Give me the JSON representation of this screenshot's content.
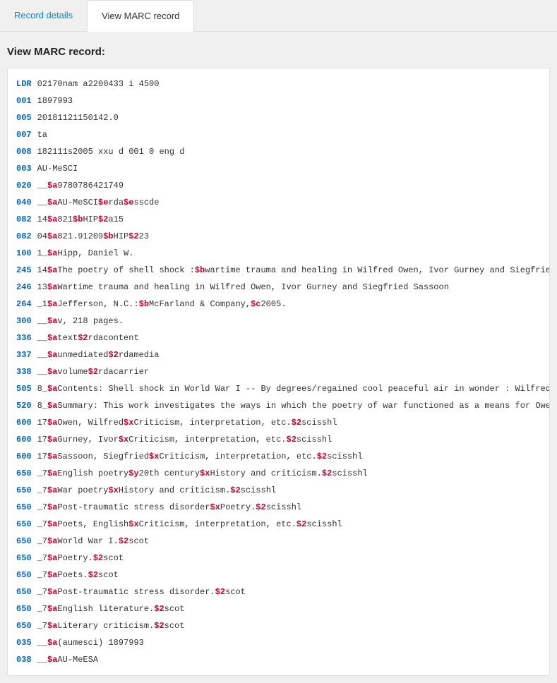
{
  "tabs": [
    {
      "label": "Record details",
      "active": false
    },
    {
      "label": "View MARC record",
      "active": true
    }
  ],
  "section_title": "View MARC record:",
  "marc": [
    {
      "tag": "LDR",
      "ind": "",
      "parts": [
        {
          "t": "txt",
          "v": "   02170nam a2200433 i 4500"
        }
      ]
    },
    {
      "tag": "001",
      "ind": "",
      "parts": [
        {
          "t": "txt",
          "v": "   1897993"
        }
      ]
    },
    {
      "tag": "005",
      "ind": "",
      "parts": [
        {
          "t": "txt",
          "v": "   20181121150142.0"
        }
      ]
    },
    {
      "tag": "007",
      "ind": "",
      "parts": [
        {
          "t": "txt",
          "v": "   ta"
        }
      ]
    },
    {
      "tag": "008",
      "ind": "",
      "parts": [
        {
          "t": "txt",
          "v": "   182111s2005    xxu    d      001 0 eng d"
        }
      ]
    },
    {
      "tag": "003",
      "ind": "",
      "parts": [
        {
          "t": "txt",
          "v": "   AU-MeSCI"
        }
      ]
    },
    {
      "tag": "020",
      "ind": "__",
      "parts": [
        {
          "t": "sub",
          "v": "$a"
        },
        {
          "t": "txt",
          "v": "9780786421749"
        }
      ]
    },
    {
      "tag": "040",
      "ind": "__",
      "parts": [
        {
          "t": "sub",
          "v": "$a"
        },
        {
          "t": "txt",
          "v": "AU-MeSCI"
        },
        {
          "t": "sub",
          "v": "$e"
        },
        {
          "t": "txt",
          "v": "rda"
        },
        {
          "t": "sub",
          "v": "$e"
        },
        {
          "t": "txt",
          "v": "sscde"
        }
      ]
    },
    {
      "tag": "082",
      "ind": "14",
      "parts": [
        {
          "t": "sub",
          "v": "$a"
        },
        {
          "t": "txt",
          "v": "821"
        },
        {
          "t": "sub",
          "v": "$b"
        },
        {
          "t": "txt",
          "v": "HIP"
        },
        {
          "t": "sub",
          "v": "$2"
        },
        {
          "t": "txt",
          "v": "a15"
        }
      ]
    },
    {
      "tag": "082",
      "ind": "04",
      "parts": [
        {
          "t": "sub",
          "v": "$a"
        },
        {
          "t": "txt",
          "v": "821.91209"
        },
        {
          "t": "sub",
          "v": "$b"
        },
        {
          "t": "txt",
          "v": "HIP"
        },
        {
          "t": "sub",
          "v": "$2"
        },
        {
          "t": "txt",
          "v": "23"
        }
      ]
    },
    {
      "tag": "100",
      "ind": "1_",
      "parts": [
        {
          "t": "sub",
          "v": "$a"
        },
        {
          "t": "txt",
          "v": "Hipp, Daniel W."
        }
      ]
    },
    {
      "tag": "245",
      "ind": "14",
      "parts": [
        {
          "t": "sub",
          "v": "$a"
        },
        {
          "t": "txt",
          "v": "The poetry of shell shock :"
        },
        {
          "t": "sub",
          "v": "$b"
        },
        {
          "t": "txt",
          "v": "wartime trauma and healing in Wilfred Owen, Ivor Gurney and Siegfried Sasso"
        }
      ]
    },
    {
      "tag": "246",
      "ind": "13",
      "parts": [
        {
          "t": "sub",
          "v": "$a"
        },
        {
          "t": "txt",
          "v": "Wartime trauma and healing in Wilfred Owen, Ivor Gurney and Siegfried Sassoon"
        }
      ]
    },
    {
      "tag": "264",
      "ind": "_1",
      "parts": [
        {
          "t": "sub",
          "v": "$a"
        },
        {
          "t": "txt",
          "v": "Jefferson, N.C.:"
        },
        {
          "t": "sub",
          "v": "$b"
        },
        {
          "t": "txt",
          "v": "McFarland & Company,"
        },
        {
          "t": "sub",
          "v": "$c"
        },
        {
          "t": "txt",
          "v": "2005."
        }
      ]
    },
    {
      "tag": "300",
      "ind": "__",
      "parts": [
        {
          "t": "sub",
          "v": "$a"
        },
        {
          "t": "txt",
          "v": "v, 218 pages."
        }
      ]
    },
    {
      "tag": "336",
      "ind": "__",
      "parts": [
        {
          "t": "sub",
          "v": "$a"
        },
        {
          "t": "txt",
          "v": "text"
        },
        {
          "t": "sub",
          "v": "$2"
        },
        {
          "t": "txt",
          "v": "rdacontent"
        }
      ]
    },
    {
      "tag": "337",
      "ind": "__",
      "parts": [
        {
          "t": "sub",
          "v": "$a"
        },
        {
          "t": "txt",
          "v": "unmediated"
        },
        {
          "t": "sub",
          "v": "$2"
        },
        {
          "t": "txt",
          "v": "rdamedia"
        }
      ]
    },
    {
      "tag": "338",
      "ind": "__",
      "parts": [
        {
          "t": "sub",
          "v": "$a"
        },
        {
          "t": "txt",
          "v": "volume"
        },
        {
          "t": "sub",
          "v": "$2"
        },
        {
          "t": "txt",
          "v": "rdacarrier"
        }
      ]
    },
    {
      "tag": "505",
      "ind": "8_",
      "parts": [
        {
          "t": "sub",
          "v": "$a"
        },
        {
          "t": "txt",
          "v": "Contents: Shell shock in World War I -- By degrees/regained cool peaceful air in wonder : Wilfred Owen, "
        }
      ]
    },
    {
      "tag": "520",
      "ind": "8_",
      "parts": [
        {
          "t": "sub",
          "v": "$a"
        },
        {
          "t": "txt",
          "v": "Summary: This work investigates the ways in which the poetry of war functioned as a means for Owen, Gurn"
        }
      ]
    },
    {
      "tag": "600",
      "ind": "17",
      "parts": [
        {
          "t": "sub",
          "v": "$a"
        },
        {
          "t": "txt",
          "v": "Owen, Wilfred"
        },
        {
          "t": "sub",
          "v": "$x"
        },
        {
          "t": "txt",
          "v": "Criticism, interpretation, etc."
        },
        {
          "t": "sub",
          "v": "$2"
        },
        {
          "t": "txt",
          "v": "scisshl"
        }
      ]
    },
    {
      "tag": "600",
      "ind": "17",
      "parts": [
        {
          "t": "sub",
          "v": "$a"
        },
        {
          "t": "txt",
          "v": "Gurney, Ivor"
        },
        {
          "t": "sub",
          "v": "$x"
        },
        {
          "t": "txt",
          "v": "Criticism, interpretation, etc."
        },
        {
          "t": "sub",
          "v": "$2"
        },
        {
          "t": "txt",
          "v": "scisshl"
        }
      ]
    },
    {
      "tag": "600",
      "ind": "17",
      "parts": [
        {
          "t": "sub",
          "v": "$a"
        },
        {
          "t": "txt",
          "v": "Sassoon, Siegfried"
        },
        {
          "t": "sub",
          "v": "$x"
        },
        {
          "t": "txt",
          "v": "Criticism, interpretation, etc."
        },
        {
          "t": "sub",
          "v": "$2"
        },
        {
          "t": "txt",
          "v": "scisshl"
        }
      ]
    },
    {
      "tag": "650",
      "ind": "_7",
      "parts": [
        {
          "t": "sub",
          "v": "$a"
        },
        {
          "t": "txt",
          "v": "English poetry"
        },
        {
          "t": "sub",
          "v": "$y"
        },
        {
          "t": "txt",
          "v": "20th century"
        },
        {
          "t": "sub",
          "v": "$x"
        },
        {
          "t": "txt",
          "v": "History and criticism."
        },
        {
          "t": "sub",
          "v": "$2"
        },
        {
          "t": "txt",
          "v": "scisshl"
        }
      ]
    },
    {
      "tag": "650",
      "ind": "_7",
      "parts": [
        {
          "t": "sub",
          "v": "$a"
        },
        {
          "t": "txt",
          "v": "War poetry"
        },
        {
          "t": "sub",
          "v": "$x"
        },
        {
          "t": "txt",
          "v": "History and criticism."
        },
        {
          "t": "sub",
          "v": "$2"
        },
        {
          "t": "txt",
          "v": "scisshl"
        }
      ]
    },
    {
      "tag": "650",
      "ind": "_7",
      "parts": [
        {
          "t": "sub",
          "v": "$a"
        },
        {
          "t": "txt",
          "v": "Post-traumatic stress disorder"
        },
        {
          "t": "sub",
          "v": "$x"
        },
        {
          "t": "txt",
          "v": "Poetry."
        },
        {
          "t": "sub",
          "v": "$2"
        },
        {
          "t": "txt",
          "v": "scisshl"
        }
      ]
    },
    {
      "tag": "650",
      "ind": "_7",
      "parts": [
        {
          "t": "sub",
          "v": "$a"
        },
        {
          "t": "txt",
          "v": "Poets, English"
        },
        {
          "t": "sub",
          "v": "$x"
        },
        {
          "t": "txt",
          "v": "Criticism, interpretation, etc."
        },
        {
          "t": "sub",
          "v": "$2"
        },
        {
          "t": "txt",
          "v": "scisshl"
        }
      ]
    },
    {
      "tag": "650",
      "ind": "_7",
      "parts": [
        {
          "t": "sub",
          "v": "$a"
        },
        {
          "t": "txt",
          "v": "World War I."
        },
        {
          "t": "sub",
          "v": "$2"
        },
        {
          "t": "txt",
          "v": "scot"
        }
      ]
    },
    {
      "tag": "650",
      "ind": "_7",
      "parts": [
        {
          "t": "sub",
          "v": "$a"
        },
        {
          "t": "txt",
          "v": "Poetry."
        },
        {
          "t": "sub",
          "v": "$2"
        },
        {
          "t": "txt",
          "v": "scot"
        }
      ]
    },
    {
      "tag": "650",
      "ind": "_7",
      "parts": [
        {
          "t": "sub",
          "v": "$a"
        },
        {
          "t": "txt",
          "v": "Poets."
        },
        {
          "t": "sub",
          "v": "$2"
        },
        {
          "t": "txt",
          "v": "scot"
        }
      ]
    },
    {
      "tag": "650",
      "ind": "_7",
      "parts": [
        {
          "t": "sub",
          "v": "$a"
        },
        {
          "t": "txt",
          "v": "Post-traumatic stress disorder."
        },
        {
          "t": "sub",
          "v": "$2"
        },
        {
          "t": "txt",
          "v": "scot"
        }
      ]
    },
    {
      "tag": "650",
      "ind": "_7",
      "parts": [
        {
          "t": "sub",
          "v": "$a"
        },
        {
          "t": "txt",
          "v": "English literature."
        },
        {
          "t": "sub",
          "v": "$2"
        },
        {
          "t": "txt",
          "v": "scot"
        }
      ]
    },
    {
      "tag": "650",
      "ind": "_7",
      "parts": [
        {
          "t": "sub",
          "v": "$a"
        },
        {
          "t": "txt",
          "v": "Literary criticism."
        },
        {
          "t": "sub",
          "v": "$2"
        },
        {
          "t": "txt",
          "v": "scot"
        }
      ]
    },
    {
      "tag": "035",
      "ind": "__",
      "parts": [
        {
          "t": "sub",
          "v": "$a"
        },
        {
          "t": "txt",
          "v": "(aumesci) 1897993"
        }
      ]
    },
    {
      "tag": "038",
      "ind": "__",
      "parts": [
        {
          "t": "sub",
          "v": "$a"
        },
        {
          "t": "txt",
          "v": "AU-MeESA"
        }
      ]
    }
  ]
}
